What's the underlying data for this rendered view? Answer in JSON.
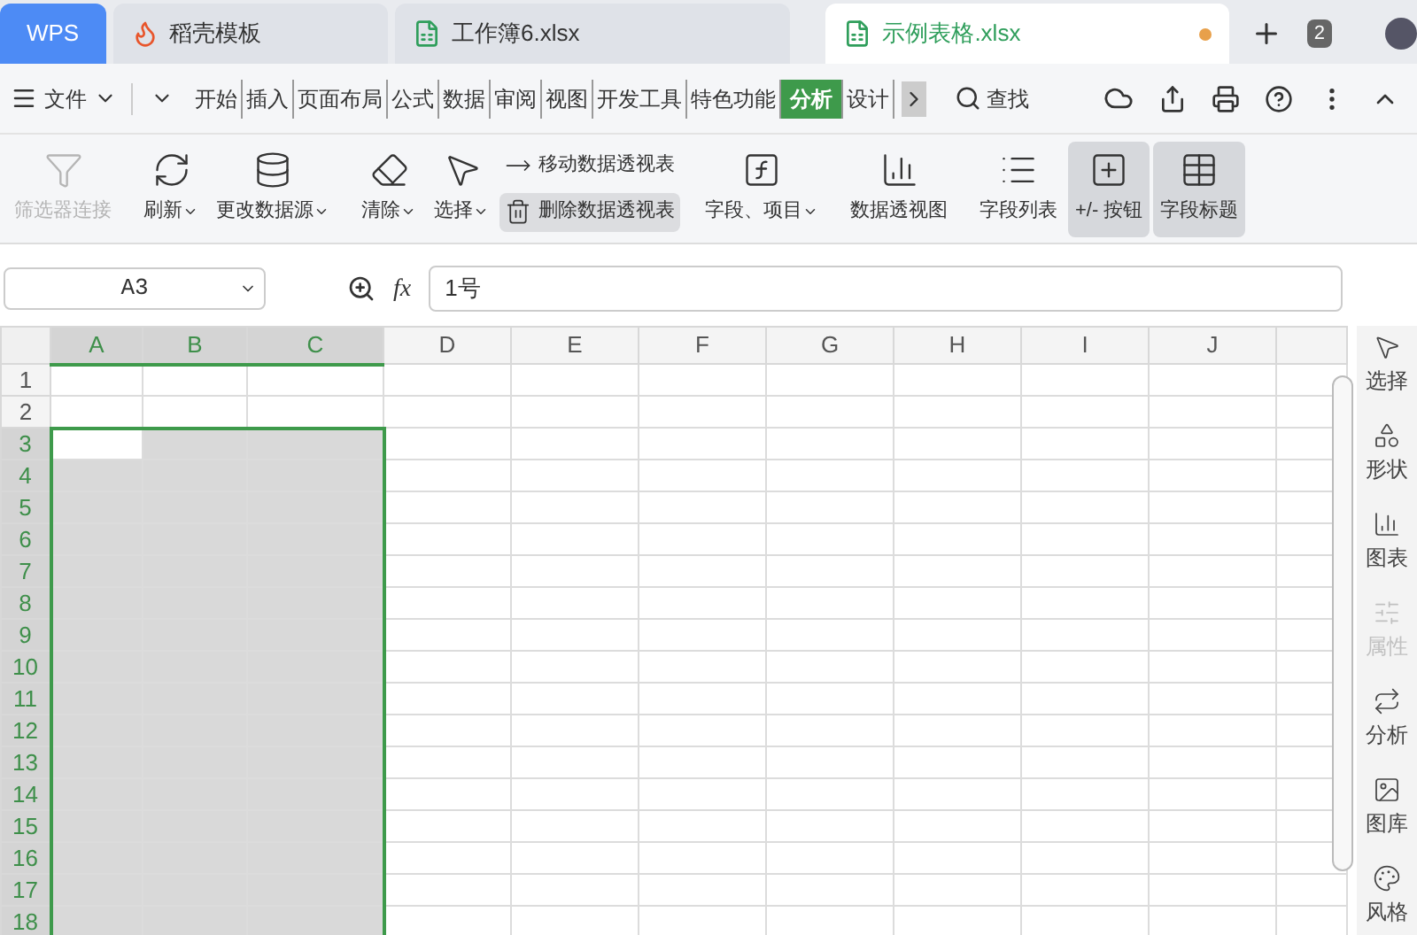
{
  "title_tabs": [
    {
      "label": "WPS",
      "kind": "home",
      "selected": false
    },
    {
      "label": "稻壳模板",
      "kind": "docer",
      "selected": false
    },
    {
      "label": "工作簿6.xlsx",
      "kind": "sheet",
      "selected": false
    },
    {
      "label": "示例表格.xlsx",
      "kind": "sheet",
      "selected": true
    }
  ],
  "window_count": "2",
  "menu": {
    "file": "文件",
    "tabs": [
      {
        "label": "开始",
        "selected": false
      },
      {
        "label": "插入",
        "selected": false
      },
      {
        "label": "页面布局",
        "selected": false
      },
      {
        "label": "公式",
        "selected": false
      },
      {
        "label": "数据",
        "selected": false
      },
      {
        "label": "审阅",
        "selected": false
      },
      {
        "label": "视图",
        "selected": false
      },
      {
        "label": "开发工具",
        "selected": false
      },
      {
        "label": "特色功能",
        "selected": false
      },
      {
        "label": "分析",
        "selected": true
      },
      {
        "label": "设计",
        "selected": false
      }
    ],
    "search": "查找"
  },
  "ribbon": [
    {
      "kind": "large",
      "label": "筛选器连接",
      "dropdown": false,
      "disabled": true,
      "selected": false
    },
    {
      "kind": "large",
      "label": "刷新",
      "dropdown": true,
      "disabled": false,
      "selected": false
    },
    {
      "kind": "large",
      "label": "更改数据源",
      "dropdown": true,
      "disabled": false,
      "selected": false
    },
    {
      "kind": "large",
      "label": "清除",
      "dropdown": true,
      "disabled": false,
      "selected": false
    },
    {
      "kind": "large",
      "label": "选择",
      "dropdown": true,
      "disabled": false,
      "selected": false
    },
    {
      "kind": "stack",
      "items": [
        {
          "label": "移动数据透视表",
          "selected": false
        },
        {
          "label": "删除数据透视表",
          "selected": true
        }
      ]
    },
    {
      "kind": "large",
      "label": "字段、项目",
      "dropdown": true,
      "disabled": false,
      "selected": false
    },
    {
      "kind": "large",
      "label": "数据透视图",
      "dropdown": false,
      "disabled": false,
      "selected": false
    },
    {
      "kind": "large",
      "label": "字段列表",
      "dropdown": false,
      "disabled": false,
      "selected": false
    },
    {
      "kind": "large",
      "label": "+/- 按钮",
      "dropdown": false,
      "disabled": false,
      "selected": true
    },
    {
      "kind": "large",
      "label": "字段标题",
      "dropdown": false,
      "disabled": false,
      "selected": true
    }
  ],
  "formula_bar": {
    "cell_ref": "A3",
    "function_label": "fx",
    "value": "1号"
  },
  "sheet": {
    "columns": [
      {
        "label": "A",
        "selected": true
      },
      {
        "label": "B",
        "selected": true
      },
      {
        "label": "C",
        "selected": true
      },
      {
        "label": "D",
        "selected": false
      },
      {
        "label": "E",
        "selected": false
      },
      {
        "label": "F",
        "selected": false
      },
      {
        "label": "G",
        "selected": false
      },
      {
        "label": "H",
        "selected": false
      },
      {
        "label": "I",
        "selected": false
      },
      {
        "label": "J",
        "selected": false
      }
    ],
    "rows": [
      {
        "label": "1",
        "selected": false
      },
      {
        "label": "2",
        "selected": false
      },
      {
        "label": "3",
        "selected": true
      },
      {
        "label": "4",
        "selected": true
      },
      {
        "label": "5",
        "selected": true
      },
      {
        "label": "6",
        "selected": true
      },
      {
        "label": "7",
        "selected": true
      },
      {
        "label": "8",
        "selected": true
      },
      {
        "label": "9",
        "selected": true
      },
      {
        "label": "10",
        "selected": true
      },
      {
        "label": "11",
        "selected": true
      },
      {
        "label": "12",
        "selected": true
      },
      {
        "label": "13",
        "selected": true
      },
      {
        "label": "14",
        "selected": true
      },
      {
        "label": "15",
        "selected": true
      },
      {
        "label": "16",
        "selected": true
      },
      {
        "label": "17",
        "selected": true
      },
      {
        "label": "18",
        "selected": true
      }
    ]
  },
  "side_panel": [
    {
      "label": "选择",
      "disabled": false
    },
    {
      "label": "形状",
      "disabled": false
    },
    {
      "label": "图表",
      "disabled": false
    },
    {
      "label": "属性",
      "disabled": true
    },
    {
      "label": "分析",
      "disabled": false
    },
    {
      "label": "图库",
      "disabled": false
    },
    {
      "label": "风格",
      "disabled": false
    }
  ]
}
